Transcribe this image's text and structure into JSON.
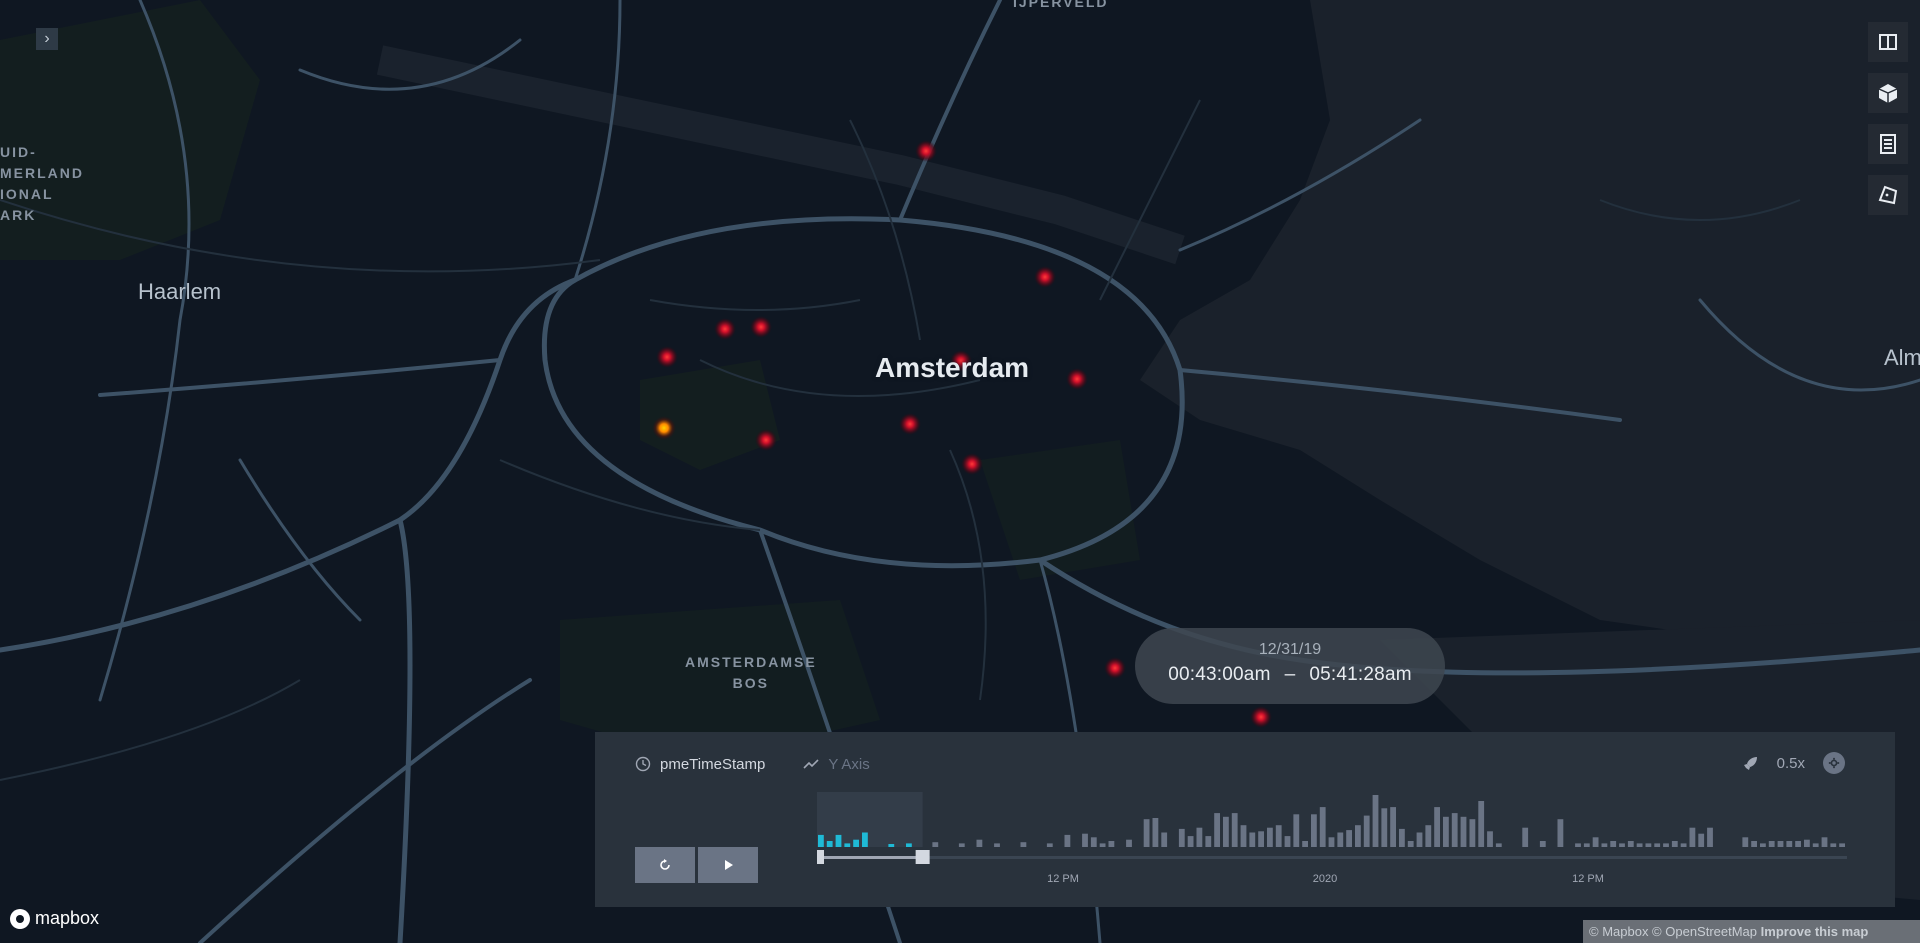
{
  "map": {
    "labels": {
      "city": "Amsterdam",
      "town": "Haarlem",
      "park": "AMSTERDAMSE\nBOS",
      "national_park": "UID-\nMERLAND\nIONAL\nARK",
      "top": "IJPERVELD",
      "edge": "Alm"
    },
    "point_colors": {
      "outer": "#7a0a16",
      "core": "#e5192d",
      "highlight": "#ffb400"
    }
  },
  "map_controls": [
    {
      "name": "split-map",
      "icon": "split-map-icon"
    },
    {
      "name": "3d-view",
      "icon": "cube-icon"
    },
    {
      "name": "legend",
      "icon": "legend-icon"
    },
    {
      "name": "draw-polygon",
      "icon": "polygon-icon"
    }
  ],
  "time_display": {
    "date": "12/31/19",
    "start": "00:43:00am",
    "separator": "–",
    "end": "05:41:28am"
  },
  "time_panel": {
    "field": "pmeTimeStamp",
    "y_axis": "Y Axis",
    "speed": "0.5x",
    "ticks": [
      "12 PM",
      "2020",
      "12 PM"
    ],
    "accent_color": "#1fbad6"
  },
  "chart_data": {
    "type": "bar",
    "title": "",
    "xlabel": "",
    "ylabel": "",
    "tick_labels": [
      "12 PM",
      "2020",
      "12 PM"
    ],
    "selected_range": {
      "start": "12/31/19 00:43:00am",
      "end": "12/31/19 05:41:28am"
    },
    "values": [
      1,
      0.5,
      1,
      0.3,
      0.6,
      1.2,
      0,
      0,
      0.2,
      0,
      0.3,
      0,
      0,
      0.4,
      0,
      0,
      0.3,
      0,
      0.6,
      0,
      0.3,
      0,
      0,
      0.4,
      0,
      0,
      0.3,
      0,
      1,
      0,
      1.1,
      0.8,
      0.3,
      0.5,
      0,
      0.6,
      0,
      2.3,
      2.4,
      1.2,
      0,
      1.5,
      0.9,
      1.6,
      0.9,
      2.8,
      2.5,
      2.8,
      1.8,
      1.2,
      1.3,
      1.6,
      1.8,
      0.9,
      2.7,
      0.5,
      2.7,
      3.3,
      0.8,
      1.2,
      1.4,
      1.8,
      2.6,
      4.3,
      3.2,
      3.3,
      1.5,
      0.5,
      1.2,
      1.8,
      3.3,
      2.5,
      2.8,
      2.5,
      2.3,
      3.8,
      1.3,
      0.3,
      0,
      0,
      1.6,
      0,
      0.5,
      0,
      2.3,
      0,
      0.3,
      0.3,
      0.8,
      0.3,
      0.5,
      0.3,
      0.5,
      0.3,
      0.3,
      0.3,
      0.3,
      0.5,
      0.3,
      1.6,
      1.1,
      1.6,
      0,
      0,
      0,
      0.8,
      0.5,
      0.3,
      0.5,
      0.5,
      0.5,
      0.5,
      0.6,
      0.3,
      0.8,
      0.3,
      0.3
    ]
  },
  "attribution": {
    "text": "© Mapbox © OpenStreetMap",
    "improve": "Improve this map"
  },
  "logo": "mapbox"
}
